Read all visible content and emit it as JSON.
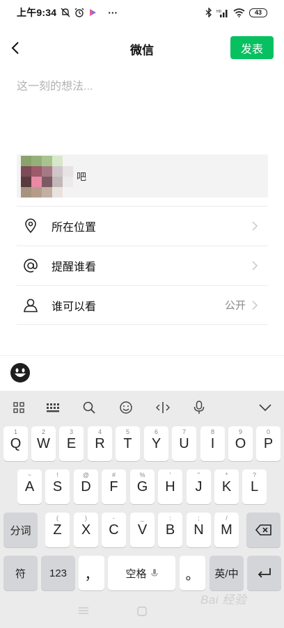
{
  "status_bar": {
    "time": "上午9:34",
    "dots": "···",
    "battery": "43",
    "left_icons": [
      "mute-icon",
      "alarm-icon",
      "app-icon"
    ],
    "right_icons": [
      "bluetooth-icon",
      "signal-icon",
      "wifi-icon",
      "battery-icon"
    ]
  },
  "header": {
    "title": "微信",
    "publish_label": "发表"
  },
  "composer": {
    "placeholder": "这一刻的想法..."
  },
  "attachment": {
    "suffix_text": "吧"
  },
  "options": [
    {
      "label": "所在位置",
      "value": "",
      "icon": "location-icon"
    },
    {
      "label": "提醒谁看",
      "value": "",
      "icon": "at-icon"
    },
    {
      "label": "谁可以看",
      "value": "公开",
      "icon": "person-icon"
    }
  ],
  "keyboard": {
    "toolbar_icons": [
      "grid-icon",
      "keypad-icon",
      "search-icon",
      "emoji-icon",
      "cursor-icon",
      "mic-icon",
      "collapse-icon"
    ],
    "row1": [
      {
        "main": "Q",
        "sub": "1"
      },
      {
        "main": "W",
        "sub": "2"
      },
      {
        "main": "E",
        "sub": "3"
      },
      {
        "main": "R",
        "sub": "4"
      },
      {
        "main": "T",
        "sub": "5"
      },
      {
        "main": "Y",
        "sub": "6"
      },
      {
        "main": "U",
        "sub": "7"
      },
      {
        "main": "I",
        "sub": "8"
      },
      {
        "main": "O",
        "sub": "9"
      },
      {
        "main": "P",
        "sub": "0"
      }
    ],
    "row2": [
      {
        "main": "A",
        "sub": "~"
      },
      {
        "main": "S",
        "sub": "!"
      },
      {
        "main": "D",
        "sub": "@"
      },
      {
        "main": "F",
        "sub": "#"
      },
      {
        "main": "G",
        "sub": "%"
      },
      {
        "main": "H",
        "sub": "'"
      },
      {
        "main": "J",
        "sub": "\""
      },
      {
        "main": "K",
        "sub": "*"
      },
      {
        "main": "L",
        "sub": "?"
      }
    ],
    "row3": [
      {
        "main": "Z",
        "sub": "("
      },
      {
        "main": "X",
        "sub": ")"
      },
      {
        "main": "C",
        "sub": "-"
      },
      {
        "main": "V",
        "sub": "_"
      },
      {
        "main": "B",
        "sub": ":"
      },
      {
        "main": "N",
        "sub": ";"
      },
      {
        "main": "M",
        "sub": "/"
      }
    ],
    "segment_label": "分词",
    "symbol_label": "符",
    "numeric_label": "123",
    "comma_label": "，",
    "space_label": "空格",
    "period_label": "。",
    "lang_label": "英/中"
  },
  "watermark": "Bai 经验"
}
